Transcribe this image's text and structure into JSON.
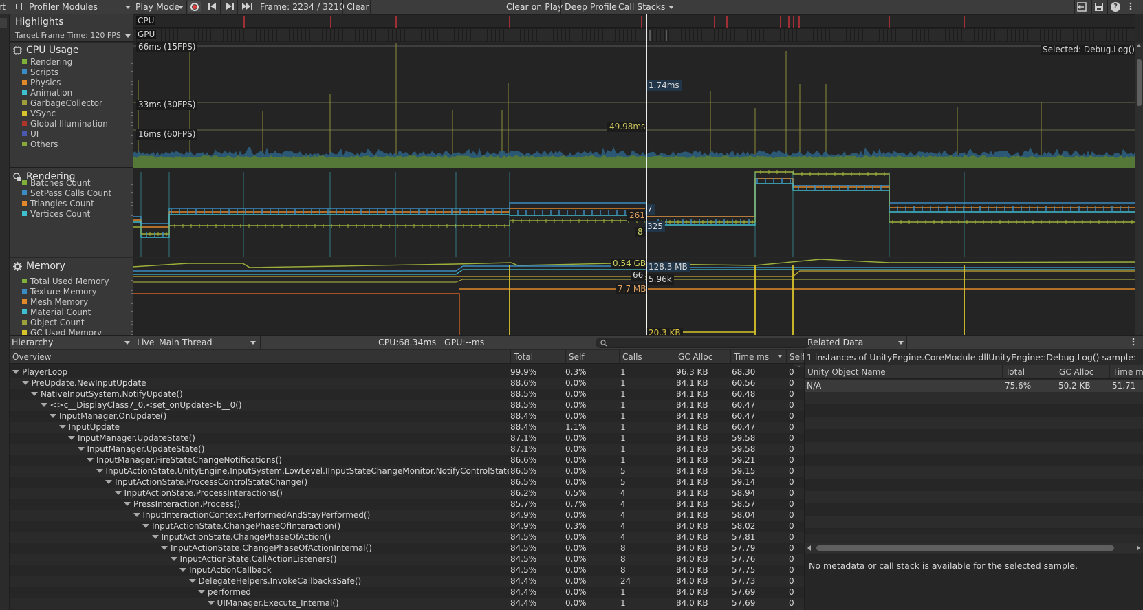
{
  "toolbar": {
    "left_cut": "rt",
    "modules_label": "Profiler Modules",
    "play_mode_label": "Play Mode",
    "frame_label": "Frame: 2234 / 3210",
    "clear_label": "Clear",
    "clear_on_play_label": "Clear on Play",
    "deep_profile_label": "Deep Profile",
    "call_stacks_label": "Call Stacks",
    "help_glyph": "?"
  },
  "highlights": {
    "title": "Highlights",
    "target_frame_time": "Target Frame Time: 120 FPS",
    "cpu_label": "CPU",
    "gpu_label": "GPU"
  },
  "cpu_usage": {
    "title": "CPU Usage",
    "legend": [
      {
        "label": "Rendering",
        "color": "#7fb03a"
      },
      {
        "label": "Scripts",
        "color": "#3a8cc2"
      },
      {
        "label": "Physics",
        "color": "#e0882a"
      },
      {
        "label": "Animation",
        "color": "#3fc0d0"
      },
      {
        "label": "GarbageCollector",
        "color": "#9c9f3a"
      },
      {
        "label": "VSync",
        "color": "#d7c42a"
      },
      {
        "label": "Global Illumination",
        "color": "#b0342a"
      },
      {
        "label": "UI",
        "color": "#4a58b0"
      },
      {
        "label": "Others",
        "color": "#88a83a"
      }
    ],
    "marker_66": "66ms (15FPS)",
    "marker_33": "33ms (30FPS)",
    "marker_16": "16ms (60FPS)",
    "selected_label": "Selected: Debug.Log()",
    "value_selected": "1.74ms",
    "value_total": "49.98ms"
  },
  "rendering": {
    "title": "Rendering",
    "legend": [
      {
        "label": "Batches Count",
        "color": "#7fb03a"
      },
      {
        "label": "SetPass Calls Count",
        "color": "#3a8cc2"
      },
      {
        "label": "Triangles Count",
        "color": "#e0882a"
      },
      {
        "label": "Vertices Count",
        "color": "#3fc0d0"
      }
    ],
    "value_261": "261",
    "value_7": "7",
    "value_325": "325",
    "value_8": "8"
  },
  "memory": {
    "title": "Memory",
    "legend": [
      {
        "label": "Total Used Memory",
        "color": "#7fb03a"
      },
      {
        "label": "Texture Memory",
        "color": "#3a8cc2"
      },
      {
        "label": "Mesh Memory",
        "color": "#e0882a"
      },
      {
        "label": "Material Count",
        "color": "#3fc0d0"
      },
      {
        "label": "Object Count",
        "color": "#9c9f3a"
      },
      {
        "label": "GC Used Memory",
        "color": "#d7c42a"
      }
    ],
    "value_054gb": "0.54 GB",
    "value_1283mb": "128.3 MB",
    "value_66": "66",
    "value_596k": "5.96k",
    "value_77mb": "7.7 MB",
    "value_203kb": "20.3 KB"
  },
  "details_toolbar": {
    "view": "Hierarchy",
    "live": "Live",
    "thread": "Main Thread",
    "timing": "CPU:68.34ms   GPU:--ms",
    "search_placeholder": ""
  },
  "hierarchy": {
    "columns": [
      "Overview",
      "Total",
      "Self",
      "Calls",
      "GC Alloc",
      "Time ms",
      "Self"
    ],
    "rows": [
      {
        "name": "PlayerLoop",
        "total": "99.9%",
        "self": "0.3%",
        "calls": "1",
        "gc": "96.3 KB",
        "time": "68.30",
        "selfms": "0"
      },
      {
        "name": "PreUpdate.NewInputUpdate",
        "total": "88.6%",
        "self": "0.0%",
        "calls": "1",
        "gc": "84.1 KB",
        "time": "60.56",
        "selfms": "0"
      },
      {
        "name": "NativeInputSystem.NotifyUpdate()",
        "total": "88.5%",
        "self": "0.0%",
        "calls": "1",
        "gc": "84.1 KB",
        "time": "60.48",
        "selfms": "0"
      },
      {
        "name": "<>c__DisplayClass7_0.<set_onUpdate>b__0()",
        "total": "88.5%",
        "self": "0.0%",
        "calls": "1",
        "gc": "84.1 KB",
        "time": "60.47",
        "selfms": "0"
      },
      {
        "name": "InputManager.OnUpdate()",
        "total": "88.4%",
        "self": "0.0%",
        "calls": "1",
        "gc": "84.1 KB",
        "time": "60.47",
        "selfms": "0"
      },
      {
        "name": "InputUpdate",
        "total": "88.4%",
        "self": "1.1%",
        "calls": "1",
        "gc": "84.1 KB",
        "time": "60.47",
        "selfms": "0"
      },
      {
        "name": "InputManager.UpdateState()",
        "total": "87.1%",
        "self": "0.0%",
        "calls": "1",
        "gc": "84.1 KB",
        "time": "59.58",
        "selfms": "0"
      },
      {
        "name": "InputManager.UpdateState()",
        "total": "87.1%",
        "self": "0.0%",
        "calls": "1",
        "gc": "84.1 KB",
        "time": "59.58",
        "selfms": "0"
      },
      {
        "name": "InputManager.FireStateChangeNotifications()",
        "total": "86.6%",
        "self": "0.0%",
        "calls": "1",
        "gc": "84.1 KB",
        "time": "59.21",
        "selfms": "0"
      },
      {
        "name": "InputActionState.UnityEngine.InputSystem.LowLevel.IInputStateChangeMonitor.NotifyControlStateChanged",
        "total": "86.5%",
        "self": "0.0%",
        "calls": "5",
        "gc": "84.1 KB",
        "time": "59.15",
        "selfms": "0"
      },
      {
        "name": "InputActionState.ProcessControlStateChange()",
        "total": "86.5%",
        "self": "0.0%",
        "calls": "5",
        "gc": "84.1 KB",
        "time": "59.14",
        "selfms": "0"
      },
      {
        "name": "InputActionState.ProcessInteractions()",
        "total": "86.2%",
        "self": "0.5%",
        "calls": "4",
        "gc": "84.1 KB",
        "time": "58.94",
        "selfms": "0"
      },
      {
        "name": "PressInteraction.Process()",
        "total": "85.7%",
        "self": "0.7%",
        "calls": "4",
        "gc": "84.1 KB",
        "time": "58.57",
        "selfms": "0"
      },
      {
        "name": "InputInteractionContext.PerformedAndStayPerformed()",
        "total": "84.9%",
        "self": "0.0%",
        "calls": "4",
        "gc": "84.1 KB",
        "time": "58.04",
        "selfms": "0"
      },
      {
        "name": "InputActionState.ChangePhaseOfInteraction()",
        "total": "84.9%",
        "self": "0.3%",
        "calls": "4",
        "gc": "84.0 KB",
        "time": "58.02",
        "selfms": "0"
      },
      {
        "name": "InputActionState.ChangePhaseOfAction()",
        "total": "84.5%",
        "self": "0.0%",
        "calls": "4",
        "gc": "84.0 KB",
        "time": "57.81",
        "selfms": "0"
      },
      {
        "name": "InputActionState.ChangePhaseOfActionInternal()",
        "total": "84.5%",
        "self": "0.0%",
        "calls": "8",
        "gc": "84.0 KB",
        "time": "57.79",
        "selfms": "0"
      },
      {
        "name": "InputActionState.CallActionListeners()",
        "total": "84.5%",
        "self": "0.0%",
        "calls": "8",
        "gc": "84.0 KB",
        "time": "57.76",
        "selfms": "0"
      },
      {
        "name": "InputActionCallback",
        "total": "84.5%",
        "self": "0.0%",
        "calls": "8",
        "gc": "84.0 KB",
        "time": "57.75",
        "selfms": "0"
      },
      {
        "name": "DelegateHelpers.InvokeCallbacksSafe()",
        "total": "84.4%",
        "self": "0.0%",
        "calls": "24",
        "gc": "84.0 KB",
        "time": "57.73",
        "selfms": "0"
      },
      {
        "name": "performed",
        "total": "84.4%",
        "self": "0.0%",
        "calls": "1",
        "gc": "84.0 KB",
        "time": "57.69",
        "selfms": "0"
      },
      {
        "name": "UIManager.Execute_Internal()",
        "total": "84.4%",
        "self": "0.0%",
        "calls": "1",
        "gc": "84.0 KB",
        "time": "57.69",
        "selfms": "0"
      }
    ]
  },
  "related": {
    "dropdown": "Related Data",
    "summary": "1 instances of UnityEngine.CoreModule.dllUnityEngine::Debug.Log() sample:",
    "columns": [
      "Unity Object Name",
      "Total",
      "GC Alloc",
      "Time m"
    ],
    "rows": [
      {
        "name": "N/A",
        "total": "75.6%",
        "gc": "50.2 KB",
        "time": "51.71"
      }
    ],
    "no_metadata": "No metadata or call stack is available for the selected sample."
  }
}
